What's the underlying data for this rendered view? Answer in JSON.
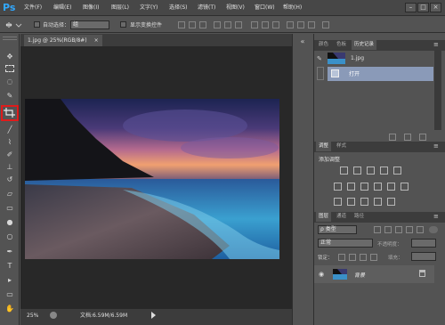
{
  "app": {
    "logo": "Ps"
  },
  "menubar": {
    "items": [
      {
        "label": "文件(F)"
      },
      {
        "label": "编辑(E)"
      },
      {
        "label": "图像(I)"
      },
      {
        "label": "图层(L)"
      },
      {
        "label": "文字(Y)"
      },
      {
        "label": "选择(S)"
      },
      {
        "label": "滤镜(T)"
      },
      {
        "label": "视图(V)"
      },
      {
        "label": "窗口(W)"
      },
      {
        "label": "帮助(H)"
      }
    ],
    "window_buttons": [
      "–",
      "□",
      "×"
    ]
  },
  "options_bar": {
    "auto_select_label": "自动选择：",
    "auto_select_value": "组",
    "transform_controls_label": "显示变换控件"
  },
  "document": {
    "tab_label": "1.jpg @ 25%(RGB/8#)",
    "close_glyph": "×",
    "zoom": "25%",
    "doc_info": "文档:6.59M/6.59M"
  },
  "history_panel": {
    "tabs": [
      {
        "label": "颜色"
      },
      {
        "label": "色板"
      },
      {
        "label": "历史记录"
      }
    ],
    "snapshot_label": "1.jpg",
    "state_label": "打开"
  },
  "adjustments_panel": {
    "tabs": [
      {
        "label": "调整"
      },
      {
        "label": "样式"
      }
    ],
    "title": "添加调整"
  },
  "layers_panel": {
    "tabs": [
      {
        "label": "图层"
      },
      {
        "label": "通道"
      },
      {
        "label": "路径"
      }
    ],
    "filter_label": "ρ 类型",
    "blend_mode": "正常",
    "opacity_label": "不透明度：",
    "lock_label": "锁定：",
    "fill_label": "填充：",
    "layer_name": "背景"
  },
  "colors": {
    "highlight": "#e01b1b",
    "ps_blue": "#31a8ff"
  }
}
